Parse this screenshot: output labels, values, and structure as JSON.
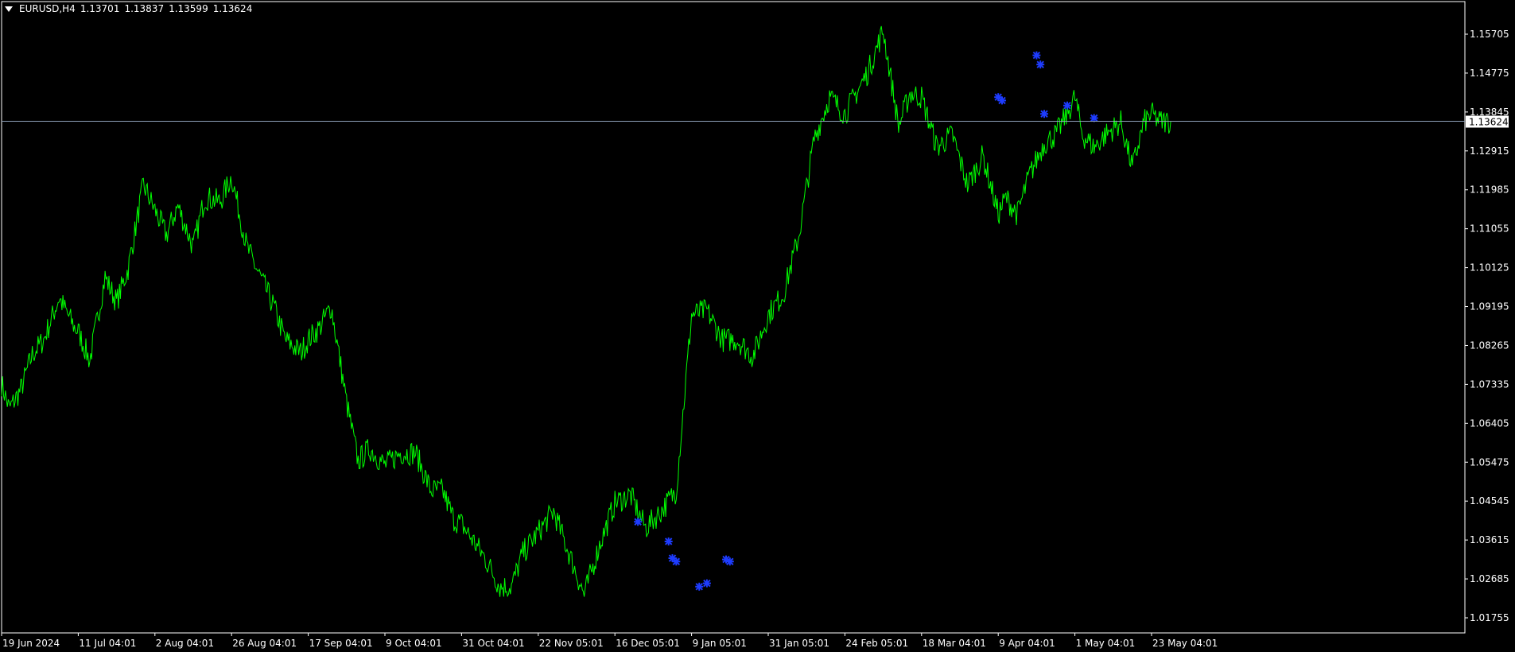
{
  "header": {
    "symbol": "EURUSD,H4",
    "open": "1.13701",
    "high": "1.13837",
    "low": "1.13599",
    "close": "1.13624"
  },
  "colors": {
    "background": "#000000",
    "price_line": "#00ff00",
    "marker": "#1e3cff",
    "axis": "#ffffff",
    "current_line": "#8ea0b8"
  },
  "current_price_label": "1.13624",
  "chart_data": {
    "type": "line",
    "y_ticks": [
      "1.15705",
      "1.14775",
      "1.13845",
      "1.12915",
      "1.11985",
      "1.11055",
      "1.10125",
      "1.09195",
      "1.08265",
      "1.07335",
      "1.06405",
      "1.05475",
      "1.04545",
      "1.03615",
      "1.02685",
      "1.01755"
    ],
    "x_ticks": [
      "19 Jun 2024",
      "11 Jul 04:01",
      "2 Aug 04:01",
      "26 Aug 04:01",
      "17 Sep 04:01",
      "9 Oct 04:01",
      "31 Oct 04:01",
      "22 Nov 05:01",
      "16 Dec 05:01",
      "9 Jan 05:01",
      "31 Jan 05:01",
      "24 Feb 05:01",
      "18 Mar 04:01",
      "9 Apr 04:01",
      "1 May 04:01",
      "23 May 04:01"
    ],
    "ylim": [
      1.014,
      1.164
    ],
    "current_price": 1.13624,
    "series": [
      {
        "x_index": [
          0,
          0.1,
          0.25,
          0.4,
          0.55,
          0.75,
          0.95,
          1,
          1.15,
          1.35,
          1.5,
          1.65,
          1.85,
          2,
          2.15,
          2.3,
          2.5,
          2.65,
          2.85,
          3,
          3.2,
          3.4,
          3.55,
          3.7,
          3.9,
          4,
          4.15,
          4.3,
          4.5,
          4.65,
          4.8,
          5,
          5.2,
          5.4,
          5.6,
          5.75,
          5.9,
          6,
          6.15,
          6.3,
          6.5,
          6.65,
          6.8,
          7,
          7.2,
          7.4,
          7.6,
          7.8,
          8,
          8.2,
          8.4,
          8.6,
          8.8,
          9,
          9.2,
          9.4,
          9.6,
          9.8,
          10,
          10.2,
          10.4,
          10.6,
          10.8,
          11,
          11.15,
          11.3,
          11.5,
          11.7,
          11.85,
          12,
          12.2,
          12.4,
          12.6,
          12.8,
          13,
          13.1,
          13.25,
          13.4,
          13.5,
          13.6,
          13.75,
          13.9,
          14,
          14.1,
          14.25,
          14.4,
          14.6,
          14.75,
          14.9,
          15,
          15.1,
          15.25
        ],
        "close": [
          1.0735,
          1.0675,
          1.072,
          1.0805,
          1.084,
          1.094,
          1.087,
          1.086,
          1.079,
          1.099,
          1.093,
          1.101,
          1.121,
          1.115,
          1.109,
          1.116,
          1.106,
          1.118,
          1.117,
          1.123,
          1.106,
          1.098,
          1.092,
          1.084,
          1.081,
          1.084,
          1.087,
          1.092,
          1.069,
          1.055,
          1.058,
          1.054,
          1.057,
          1.057,
          1.048,
          1.048,
          1.041,
          1.04,
          1.036,
          1.032,
          1.025,
          1.025,
          1.033,
          1.038,
          1.043,
          1.033,
          1.023,
          1.035,
          1.045,
          1.047,
          1.039,
          1.043,
          1.048,
          1.09,
          1.091,
          1.084,
          1.084,
          1.08,
          1.09,
          1.095,
          1.109,
          1.132,
          1.142,
          1.138,
          1.143,
          1.148,
          1.158,
          1.135,
          1.143,
          1.142,
          1.13,
          1.133,
          1.121,
          1.128,
          1.114,
          1.118,
          1.114,
          1.123,
          1.127,
          1.131,
          1.133,
          1.138,
          1.142,
          1.133,
          1.13,
          1.133,
          1.136,
          1.125,
          1.136,
          1.138,
          1.1362,
          1.1362
        ],
        "noise_amp": 0.003
      }
    ],
    "markers": [
      {
        "x_index": 8.3,
        "value": 1.0405
      },
      {
        "x_index": 8.7,
        "value": 1.0358
      },
      {
        "x_index": 8.75,
        "value": 1.0318
      },
      {
        "x_index": 8.8,
        "value": 1.031
      },
      {
        "x_index": 9.1,
        "value": 1.025
      },
      {
        "x_index": 9.2,
        "value": 1.0258
      },
      {
        "x_index": 9.45,
        "value": 1.0315
      },
      {
        "x_index": 9.5,
        "value": 1.031
      },
      {
        "x_index": 13.0,
        "value": 1.142
      },
      {
        "x_index": 13.05,
        "value": 1.1412
      },
      {
        "x_index": 13.5,
        "value": 1.152
      },
      {
        "x_index": 13.55,
        "value": 1.1498
      },
      {
        "x_index": 13.6,
        "value": 1.138
      },
      {
        "x_index": 13.9,
        "value": 1.14
      },
      {
        "x_index": 14.25,
        "value": 1.137
      }
    ]
  }
}
